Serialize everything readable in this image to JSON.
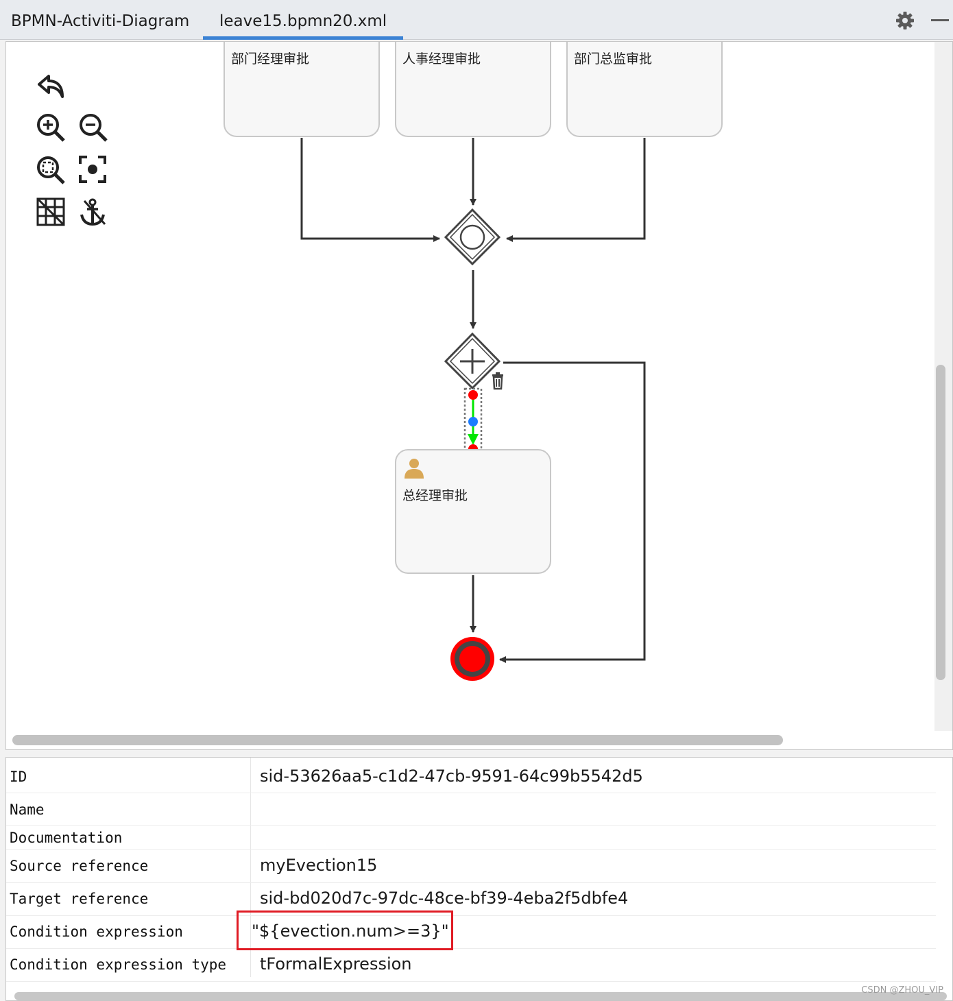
{
  "tabs": [
    {
      "label": "BPMN-Activiti-Diagram",
      "active": false
    },
    {
      "label": "leave15.bpmn20.xml",
      "active": true
    }
  ],
  "toolbar": {
    "icons": [
      "undo-icon",
      "zoom-in-icon",
      "zoom-out-icon",
      "zoom-fit-icon",
      "zoom-actual-icon",
      "grid-icon",
      "anchor-icon"
    ]
  },
  "diagram": {
    "tasks": [
      {
        "label": "部门经理审批"
      },
      {
        "label": "人事经理审批"
      },
      {
        "label": "部门总监审批"
      },
      {
        "label": "总经理审批"
      }
    ],
    "inclusive_gateway": "inclusive-gateway",
    "parallel_gateway": "parallel-gateway",
    "end_event": "end-event",
    "colors": {
      "selected_flow": "#00e600",
      "handle_end": "#ff0000",
      "handle_mid": "#1a7cff",
      "end_event_fill": "#ff0000"
    }
  },
  "properties": {
    "rows": [
      {
        "key": "ID",
        "value": "sid-53626aa5-c1d2-47cb-9591-64c99b5542d5"
      },
      {
        "key": "Name",
        "value": ""
      },
      {
        "key": "Documentation",
        "value": ""
      },
      {
        "key": "Source reference",
        "value": "myEvection15"
      },
      {
        "key": "Target reference",
        "value": "sid-bd020d7c-97dc-48ce-bf39-4eba2f5dbfe4"
      },
      {
        "key": "Condition expression",
        "value": "\"${evection.num>=3}\""
      },
      {
        "key": "Condition expression type",
        "value": "tFormalExpression"
      }
    ]
  },
  "watermark": "CSDN @ZHOU_VIP"
}
